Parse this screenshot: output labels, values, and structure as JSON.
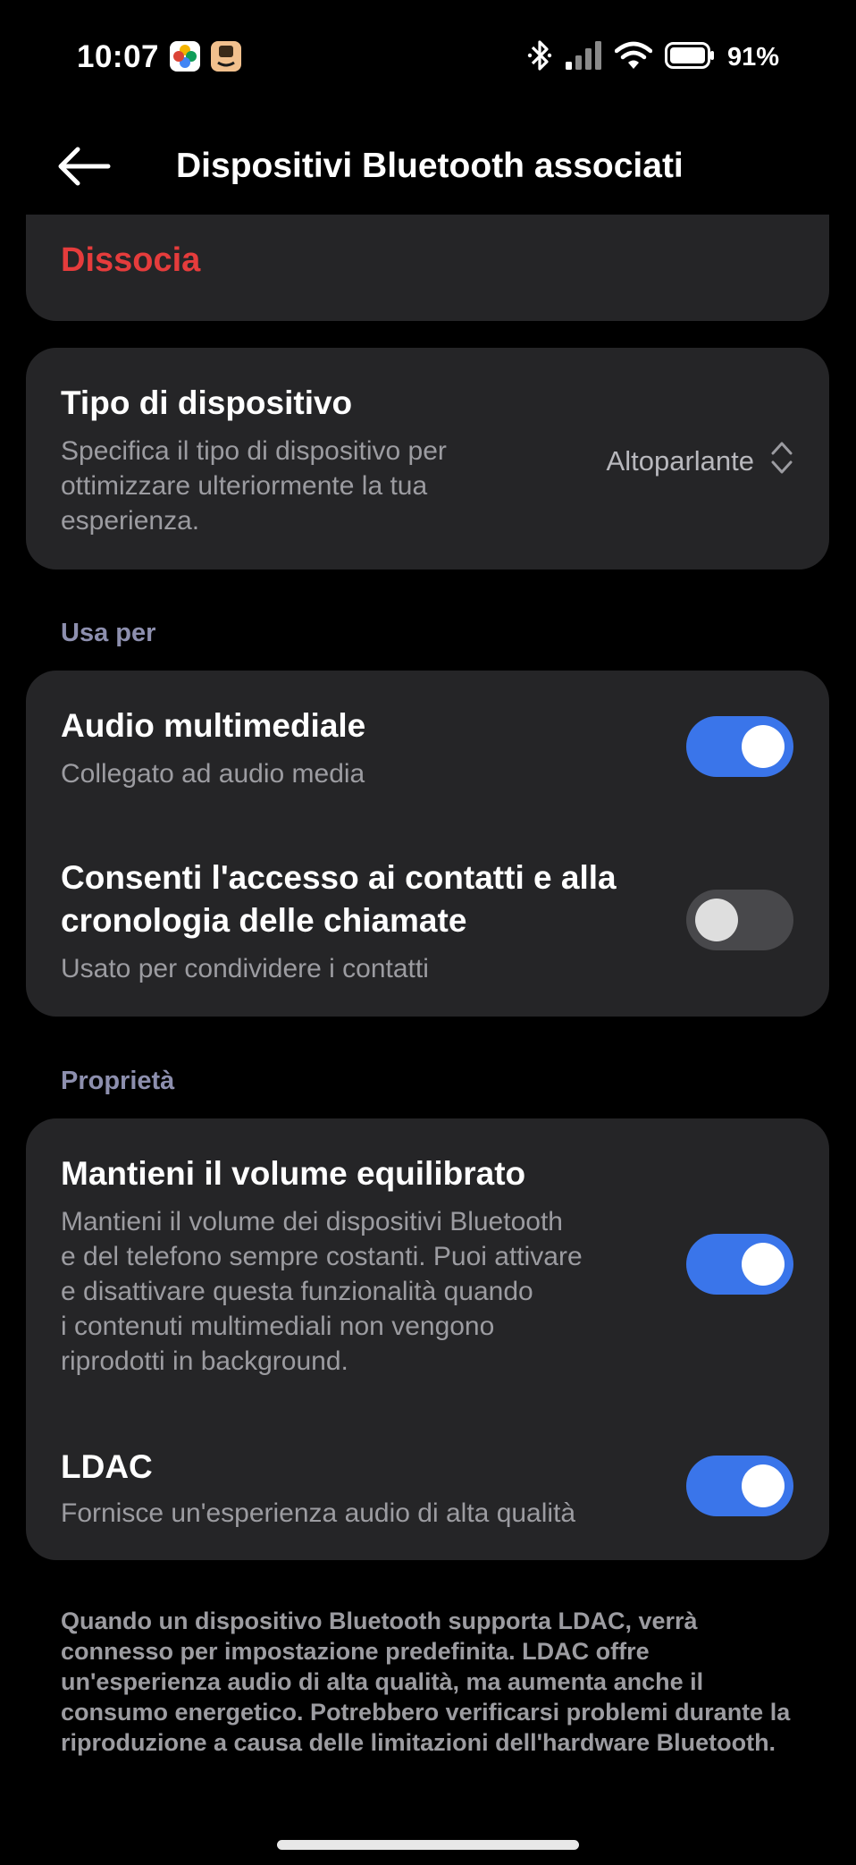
{
  "status_bar": {
    "time": "10:07",
    "battery_percent": "91%",
    "icons": [
      "photos-app-icon",
      "amazon-app-icon",
      "bluetooth-icon",
      "signal-icon",
      "wifi-icon",
      "battery-icon"
    ]
  },
  "header": {
    "title": "Dispositivi Bluetooth associati",
    "back_icon": "arrow-left-icon"
  },
  "unpair": {
    "label": "Dissocia",
    "color": "#e53c3c"
  },
  "device_type": {
    "title": "Tipo di dispositivo",
    "subtitle_lines": [
      "Specifica il tipo di dispositivo per",
      "ottimizzare ulteriormente la tua",
      "esperienza."
    ],
    "value": "Altoparlante",
    "value_icon": "chevron-up-down-icon"
  },
  "use_for": {
    "header": "Usa per",
    "items": [
      {
        "title_lines": [
          "Audio multimediale"
        ],
        "subtitle": "Collegato ad audio media",
        "enabled": true
      },
      {
        "title_lines": [
          "Consenti l'accesso ai contatti e alla",
          "cronologia delle chiamate"
        ],
        "subtitle": "Usato per condividere i contatti",
        "enabled": false
      }
    ]
  },
  "properties": {
    "header": "Proprietà",
    "items": [
      {
        "title": "Mantieni il volume equilibrato",
        "subtitle_lines": [
          "Mantieni il volume dei dispositivi Bluetooth",
          "e del telefono sempre costanti. Puoi attivare",
          "e disattivare questa funzionalità quando",
          "i contenuti multimediali non vengono",
          "riprodotti in background."
        ],
        "enabled": true
      },
      {
        "title": "LDAC",
        "subtitle_lines": [
          "Fornisce un'esperienza audio di alta qualità"
        ],
        "enabled": true
      }
    ]
  },
  "footnote_lines": [
    "Quando un dispositivo Bluetooth supporta LDAC, verrà",
    "connesso per impostazione predefinita. LDAC offre",
    "un'esperienza audio di alta qualità, ma aumenta anche il",
    "consumo energetico. Potrebbero verificarsi problemi durante la",
    "riproduzione a causa delle limitazioni dell'hardware Bluetooth."
  ],
  "colors": {
    "background": "#000000",
    "card": "#252527",
    "accent": "#3a75ea",
    "danger": "#e53c3c",
    "section_header": "#8d8fae",
    "secondary_text": "#9c9ca1"
  }
}
